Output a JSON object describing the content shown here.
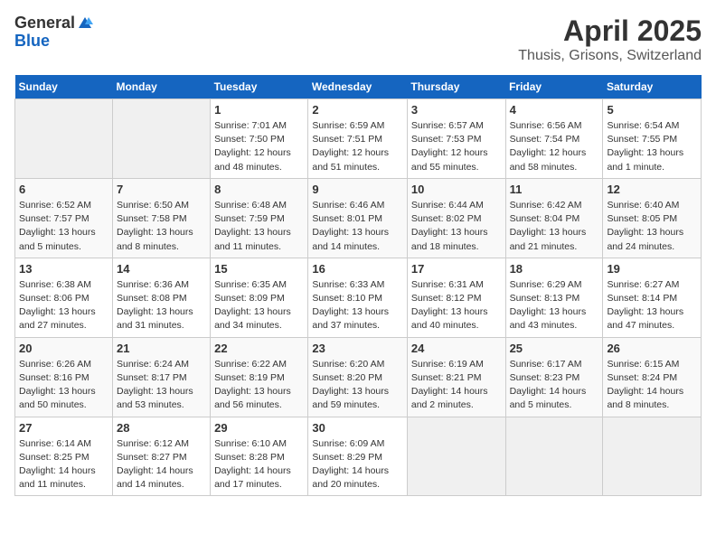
{
  "header": {
    "logo_general": "General",
    "logo_blue": "Blue",
    "month_year": "April 2025",
    "location": "Thusis, Grisons, Switzerland"
  },
  "days_of_week": [
    "Sunday",
    "Monday",
    "Tuesday",
    "Wednesday",
    "Thursday",
    "Friday",
    "Saturday"
  ],
  "weeks": [
    [
      {
        "day": "",
        "info": ""
      },
      {
        "day": "",
        "info": ""
      },
      {
        "day": "1",
        "info": "Sunrise: 7:01 AM\nSunset: 7:50 PM\nDaylight: 12 hours and 48 minutes."
      },
      {
        "day": "2",
        "info": "Sunrise: 6:59 AM\nSunset: 7:51 PM\nDaylight: 12 hours and 51 minutes."
      },
      {
        "day": "3",
        "info": "Sunrise: 6:57 AM\nSunset: 7:53 PM\nDaylight: 12 hours and 55 minutes."
      },
      {
        "day": "4",
        "info": "Sunrise: 6:56 AM\nSunset: 7:54 PM\nDaylight: 12 hours and 58 minutes."
      },
      {
        "day": "5",
        "info": "Sunrise: 6:54 AM\nSunset: 7:55 PM\nDaylight: 13 hours and 1 minute."
      }
    ],
    [
      {
        "day": "6",
        "info": "Sunrise: 6:52 AM\nSunset: 7:57 PM\nDaylight: 13 hours and 5 minutes."
      },
      {
        "day": "7",
        "info": "Sunrise: 6:50 AM\nSunset: 7:58 PM\nDaylight: 13 hours and 8 minutes."
      },
      {
        "day": "8",
        "info": "Sunrise: 6:48 AM\nSunset: 7:59 PM\nDaylight: 13 hours and 11 minutes."
      },
      {
        "day": "9",
        "info": "Sunrise: 6:46 AM\nSunset: 8:01 PM\nDaylight: 13 hours and 14 minutes."
      },
      {
        "day": "10",
        "info": "Sunrise: 6:44 AM\nSunset: 8:02 PM\nDaylight: 13 hours and 18 minutes."
      },
      {
        "day": "11",
        "info": "Sunrise: 6:42 AM\nSunset: 8:04 PM\nDaylight: 13 hours and 21 minutes."
      },
      {
        "day": "12",
        "info": "Sunrise: 6:40 AM\nSunset: 8:05 PM\nDaylight: 13 hours and 24 minutes."
      }
    ],
    [
      {
        "day": "13",
        "info": "Sunrise: 6:38 AM\nSunset: 8:06 PM\nDaylight: 13 hours and 27 minutes."
      },
      {
        "day": "14",
        "info": "Sunrise: 6:36 AM\nSunset: 8:08 PM\nDaylight: 13 hours and 31 minutes."
      },
      {
        "day": "15",
        "info": "Sunrise: 6:35 AM\nSunset: 8:09 PM\nDaylight: 13 hours and 34 minutes."
      },
      {
        "day": "16",
        "info": "Sunrise: 6:33 AM\nSunset: 8:10 PM\nDaylight: 13 hours and 37 minutes."
      },
      {
        "day": "17",
        "info": "Sunrise: 6:31 AM\nSunset: 8:12 PM\nDaylight: 13 hours and 40 minutes."
      },
      {
        "day": "18",
        "info": "Sunrise: 6:29 AM\nSunset: 8:13 PM\nDaylight: 13 hours and 43 minutes."
      },
      {
        "day": "19",
        "info": "Sunrise: 6:27 AM\nSunset: 8:14 PM\nDaylight: 13 hours and 47 minutes."
      }
    ],
    [
      {
        "day": "20",
        "info": "Sunrise: 6:26 AM\nSunset: 8:16 PM\nDaylight: 13 hours and 50 minutes."
      },
      {
        "day": "21",
        "info": "Sunrise: 6:24 AM\nSunset: 8:17 PM\nDaylight: 13 hours and 53 minutes."
      },
      {
        "day": "22",
        "info": "Sunrise: 6:22 AM\nSunset: 8:19 PM\nDaylight: 13 hours and 56 minutes."
      },
      {
        "day": "23",
        "info": "Sunrise: 6:20 AM\nSunset: 8:20 PM\nDaylight: 13 hours and 59 minutes."
      },
      {
        "day": "24",
        "info": "Sunrise: 6:19 AM\nSunset: 8:21 PM\nDaylight: 14 hours and 2 minutes."
      },
      {
        "day": "25",
        "info": "Sunrise: 6:17 AM\nSunset: 8:23 PM\nDaylight: 14 hours and 5 minutes."
      },
      {
        "day": "26",
        "info": "Sunrise: 6:15 AM\nSunset: 8:24 PM\nDaylight: 14 hours and 8 minutes."
      }
    ],
    [
      {
        "day": "27",
        "info": "Sunrise: 6:14 AM\nSunset: 8:25 PM\nDaylight: 14 hours and 11 minutes."
      },
      {
        "day": "28",
        "info": "Sunrise: 6:12 AM\nSunset: 8:27 PM\nDaylight: 14 hours and 14 minutes."
      },
      {
        "day": "29",
        "info": "Sunrise: 6:10 AM\nSunset: 8:28 PM\nDaylight: 14 hours and 17 minutes."
      },
      {
        "day": "30",
        "info": "Sunrise: 6:09 AM\nSunset: 8:29 PM\nDaylight: 14 hours and 20 minutes."
      },
      {
        "day": "",
        "info": ""
      },
      {
        "day": "",
        "info": ""
      },
      {
        "day": "",
        "info": ""
      }
    ]
  ]
}
